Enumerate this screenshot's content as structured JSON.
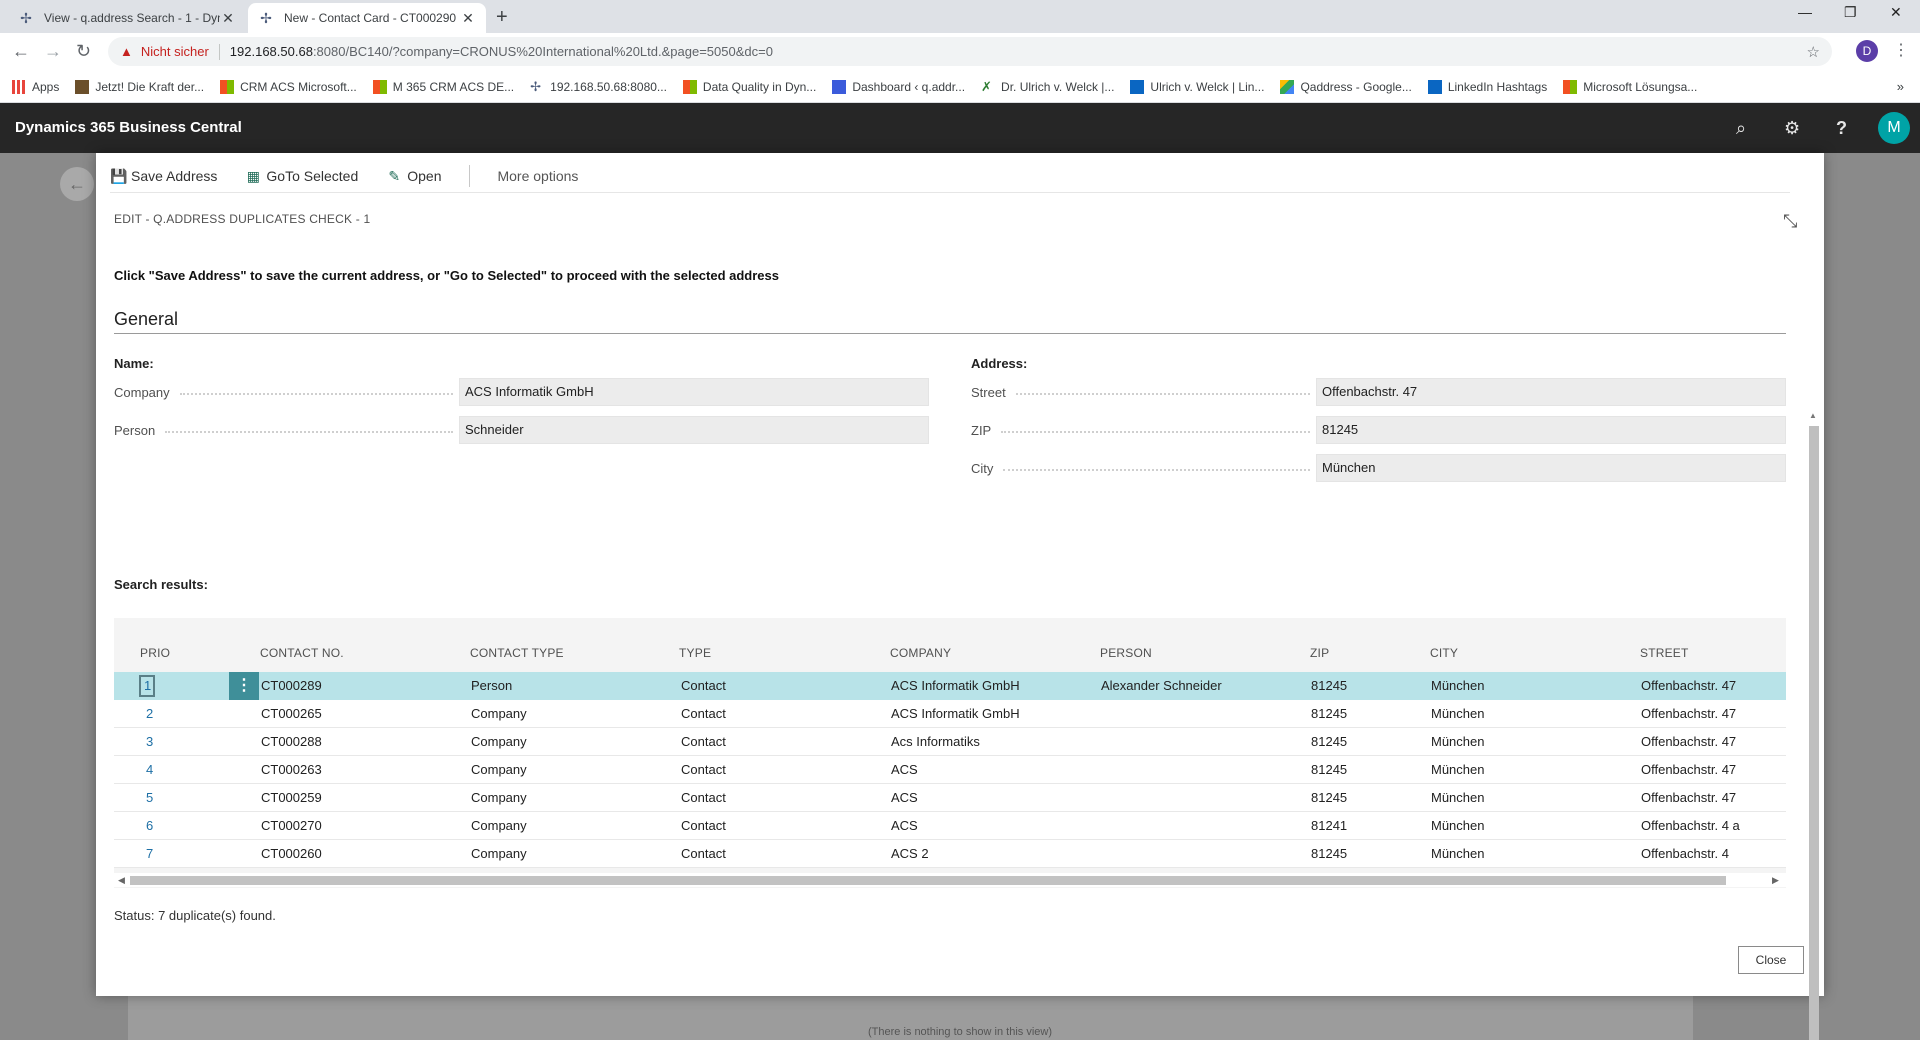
{
  "browser": {
    "tabs": [
      {
        "title": "View - q.address Search - 1 - Dyn",
        "active": false
      },
      {
        "title": "New - Contact Card - CT000290",
        "active": true
      }
    ],
    "omnibox": {
      "security": "Nicht sicher",
      "url_host": "192.168.50.68",
      "url_rest": ":8080/BC140/?company=CRONUS%20International%20Ltd.&page=5050&dc=0"
    },
    "profile_initial": "D",
    "bookmarks": [
      {
        "label": "Apps",
        "color": "#e8453c"
      },
      {
        "label": "Jetzt! Die Kraft der...",
        "color": "#6b4f2a"
      },
      {
        "label": "CRM ACS Microsoft...",
        "color": "#f25022"
      },
      {
        "label": "M 365 CRM ACS DE...",
        "color": "#f25022"
      },
      {
        "label": "192.168.50.68:8080...",
        "color": "#4a5a7a"
      },
      {
        "label": "Data Quality in Dyn...",
        "color": "#f25022"
      },
      {
        "label": "Dashboard ‹ q.addr...",
        "color": "#3b5bdb"
      },
      {
        "label": "Dr. Ulrich v. Welck |...",
        "color": "#2e7d32"
      },
      {
        "label": "Ulrich v. Welck | Lin...",
        "color": "#0a66c2"
      },
      {
        "label": "Qaddress - Google...",
        "color": "#fbbc04"
      },
      {
        "label": "LinkedIn Hashtags",
        "color": "#0a66c2"
      },
      {
        "label": "Microsoft Lösungsa...",
        "color": "#f25022"
      }
    ]
  },
  "app": {
    "title": "Dynamics 365 Business Central",
    "avatar_initial": "M",
    "background_note": "(There is nothing to show in this view)"
  },
  "dialog": {
    "actions": {
      "save_address": "Save Address",
      "goto_selected": "GoTo Selected",
      "open": "Open",
      "more_options": "More options"
    },
    "caption": "EDIT - Q.ADDRESS DUPLICATES CHECK - 1",
    "instruction": "Click \"Save Address\" to save the current address, or \"Go to Selected\" to proceed with the selected address",
    "section_title": "General",
    "name_group": {
      "heading": "Name:",
      "company_label": "Company",
      "company_value": "ACS Informatik GmbH",
      "person_label": "Person",
      "person_value": "Schneider"
    },
    "address_group": {
      "heading": "Address:",
      "street_label": "Street",
      "street_value": "Offenbachstr. 47",
      "zip_label": "ZIP",
      "zip_value": "81245",
      "city_label": "City",
      "city_value": "München"
    },
    "search_results_label": "Search results:",
    "columns": {
      "prio": "PRIO",
      "contact_no": "CONTACT NO.",
      "contact_type": "CONTACT TYPE",
      "type": "TYPE",
      "company": "COMPANY",
      "person": "PERSON",
      "zip": "ZIP",
      "city": "CITY",
      "street": "STREET"
    },
    "rows": [
      {
        "prio": "1",
        "contact_no": "CT000289",
        "contact_type": "Person",
        "type": "Contact",
        "company": "ACS Informatik GmbH",
        "person": "Alexander Schneider",
        "zip": "81245",
        "city": "München",
        "street": "Offenbachstr. 47",
        "selected": true
      },
      {
        "prio": "2",
        "contact_no": "CT000265",
        "contact_type": "Company",
        "type": "Contact",
        "company": "ACS Informatik GmbH",
        "person": "",
        "zip": "81245",
        "city": "München",
        "street": "Offenbachstr. 47",
        "selected": false
      },
      {
        "prio": "3",
        "contact_no": "CT000288",
        "contact_type": "Company",
        "type": "Contact",
        "company": "Acs Informatiks",
        "person": "",
        "zip": "81245",
        "city": "München",
        "street": "Offenbachstr. 47",
        "selected": false
      },
      {
        "prio": "4",
        "contact_no": "CT000263",
        "contact_type": "Company",
        "type": "Contact",
        "company": "ACS",
        "person": "",
        "zip": "81245",
        "city": "München",
        "street": "Offenbachstr. 47",
        "selected": false
      },
      {
        "prio": "5",
        "contact_no": "CT000259",
        "contact_type": "Company",
        "type": "Contact",
        "company": "ACS",
        "person": "",
        "zip": "81245",
        "city": "München",
        "street": "Offenbachstr. 47",
        "selected": false
      },
      {
        "prio": "6",
        "contact_no": "CT000270",
        "contact_type": "Company",
        "type": "Contact",
        "company": "ACS",
        "person": "",
        "zip": "81241",
        "city": "München",
        "street": "Offenbachstr. 4 a",
        "selected": false
      },
      {
        "prio": "7",
        "contact_no": "CT000260",
        "contact_type": "Company",
        "type": "Contact",
        "company": "ACS 2",
        "person": "",
        "zip": "81245",
        "city": "München",
        "street": "Offenbachstr. 4",
        "selected": false
      }
    ],
    "status": "Status: 7 duplicate(s) found.",
    "close_label": "Close"
  },
  "colors": {
    "header_bg": "#262626",
    "selected_row": "#b8e3e8",
    "accent_teal": "#00a3a6",
    "prio_link": "#1d6fa5",
    "insecure_red": "#c5221f"
  }
}
